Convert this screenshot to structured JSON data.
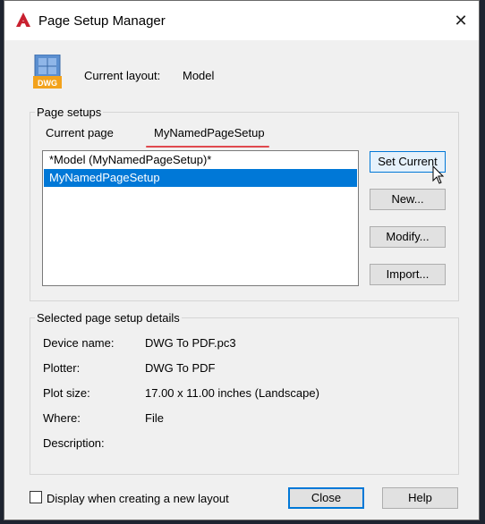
{
  "window": {
    "title": "Page Setup Manager",
    "close_glyph": "✕"
  },
  "current_layout": {
    "label": "Current layout:",
    "value": "Model",
    "icon_text": "DWG"
  },
  "page_setups": {
    "group_label": "Page setups",
    "current_page_label": "Current page",
    "current_page_value": "MyNamedPageSetup",
    "items": [
      {
        "label": "*Model (MyNamedPageSetup)*",
        "selected": false
      },
      {
        "label": "MyNamedPageSetup",
        "selected": true
      }
    ]
  },
  "buttons": {
    "set_current": "Set Current",
    "new": "New...",
    "modify": "Modify...",
    "import": "Import...",
    "close": "Close",
    "help": "Help"
  },
  "details": {
    "group_label": "Selected page setup details",
    "device_name_label": "Device name:",
    "device_name_value": "DWG To PDF.pc3",
    "plotter_label": "Plotter:",
    "plotter_value": "DWG To PDF",
    "plot_size_label": "Plot size:",
    "plot_size_value": "17.00 x 11.00 inches (Landscape)",
    "where_label": "Where:",
    "where_value": "File",
    "description_label": "Description:",
    "description_value": ""
  },
  "footer": {
    "checkbox_label": "Display when creating a new layout",
    "checkbox_checked": false
  },
  "colors": {
    "accent": "#0078d7",
    "highlight_underline": "#e0494e",
    "app_icon_red": "#c8202f"
  }
}
